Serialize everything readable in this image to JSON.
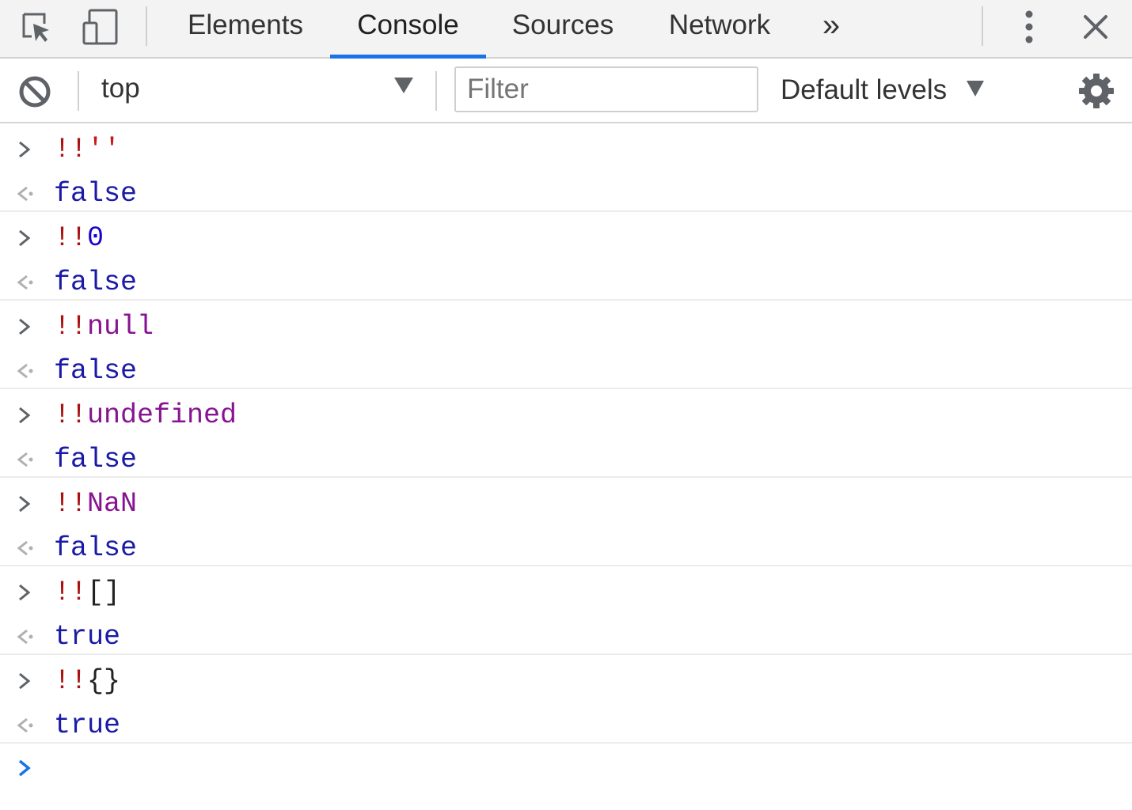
{
  "tabs": {
    "items": [
      {
        "label": "Elements",
        "active": false
      },
      {
        "label": "Console",
        "active": true
      },
      {
        "label": "Sources",
        "active": false
      },
      {
        "label": "Network",
        "active": false
      }
    ],
    "overflow_label": "»",
    "icons": {
      "inspect": "inspect-element-icon",
      "device": "device-toolbar-icon",
      "more": "kebab-menu-icon",
      "close": "close-icon"
    }
  },
  "toolbar": {
    "clear_icon": "clear-console-icon",
    "context": "top",
    "filter_placeholder": "Filter",
    "filter_value": "",
    "levels_label": "Default levels",
    "settings_icon": "gear-icon"
  },
  "console": {
    "entries": [
      {
        "prefix": "!!",
        "operand": "''",
        "result": "false"
      },
      {
        "prefix": "!!",
        "operand": "0",
        "result": "false"
      },
      {
        "prefix": "!!",
        "operand": "null",
        "result": "false"
      },
      {
        "prefix": "!!",
        "operand": "undefined",
        "result": "false"
      },
      {
        "prefix": "!!",
        "operand": "NaN",
        "result": "false"
      },
      {
        "prefix": "!!",
        "operand": "[]",
        "result": "true"
      },
      {
        "prefix": "!!",
        "operand": "{}",
        "result": "true"
      }
    ]
  },
  "colors": {
    "accent": "#1a73e8",
    "bang": "#aa1111",
    "number": "#1c00cf",
    "keyword": "#881391",
    "result": "#1a1aa6"
  }
}
